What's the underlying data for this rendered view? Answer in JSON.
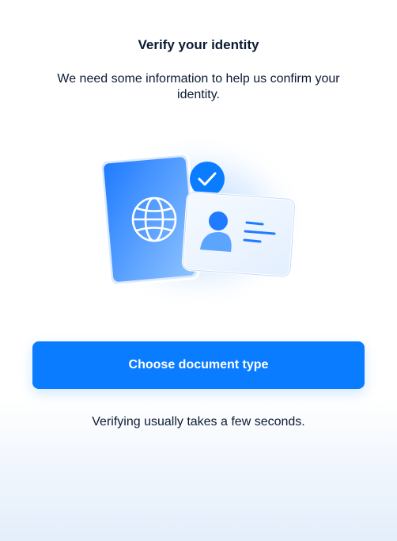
{
  "header": {
    "title": "Verify your identity",
    "subtitle": "We need some information to help us confirm your identity."
  },
  "illustration": {
    "icons": [
      "passport-icon",
      "globe-icon",
      "checkmark-badge-icon",
      "id-card-icon",
      "person-icon"
    ],
    "accent_color": "#0a7cff"
  },
  "actions": {
    "choose_document_label": "Choose document type"
  },
  "footer": {
    "note": "Verifying usually takes a few seconds."
  },
  "colors": {
    "primary": "#0a7cff",
    "text": "#0c1b33"
  }
}
